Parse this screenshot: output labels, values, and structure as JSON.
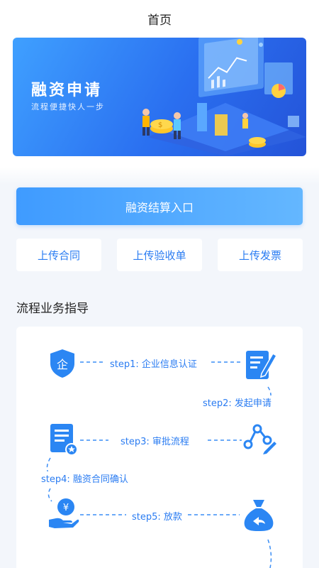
{
  "nav": {
    "title": "首页"
  },
  "banner": {
    "title": "融资申请",
    "subtitle": "流程便捷快人一步"
  },
  "primary_button": {
    "label": "融资结算入口"
  },
  "upload_buttons": [
    {
      "label": "上传合同"
    },
    {
      "label": "上传验收单"
    },
    {
      "label": "上传发票"
    }
  ],
  "guide": {
    "title": "流程业务指导",
    "steps": [
      {
        "label": "step1: 企业信息认证",
        "icon": "enterprise-shield-icon"
      },
      {
        "label": "step2: 发起申请",
        "icon": "document-edit-icon"
      },
      {
        "label": "step3: 审批流程",
        "icon": "approval-flow-icon"
      },
      {
        "label": "step4: 融资合同确认",
        "icon": "contract-star-icon"
      },
      {
        "label": "step5: 放款",
        "icon": "loan-hand-icon"
      }
    ],
    "end_icon": "money-bag-return-icon",
    "badge_text": {
      "enterprise": "企",
      "yuan": "¥"
    }
  },
  "colors": {
    "accent": "#2a7cf2",
    "accent_light": "#64b7ff",
    "icon_blue": "#2b86f3"
  }
}
